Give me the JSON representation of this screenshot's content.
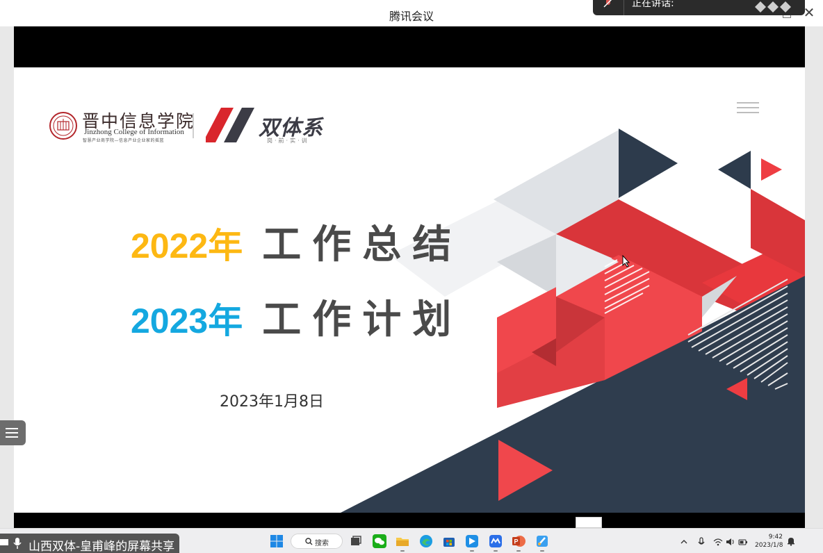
{
  "window": {
    "title": "腾讯会议"
  },
  "speaking": {
    "text": "正在讲话:"
  },
  "slide": {
    "school_name_cn": "晋中信息学院",
    "school_name_en": "Jinzhong College of Information",
    "school_motto": "智慧产业商学院—信息产业企业家的摇篮",
    "brand_name": "双体系",
    "brand_sub": "岗·前·实·训",
    "heading1": {
      "year": "2022年",
      "text": "工作总结"
    },
    "heading2": {
      "year": "2023年",
      "text": "工作计划"
    },
    "date": "2023年1月8日"
  },
  "screen_share": {
    "label": "山西双体-皇甫峰的屏幕共享"
  },
  "taskbar": {
    "search_label": "搜索",
    "apps": [
      "task-view",
      "wechat",
      "file-explorer",
      "edge",
      "microsoft-store",
      "app-blue",
      "tencent-meeting",
      "powerpoint",
      "paint"
    ],
    "time": "9:42",
    "date": "2023/1/8"
  },
  "colors": {
    "year_2022": "#fdb813",
    "year_2023": "#14a8e0",
    "red": "#e8383d",
    "navy": "#2b3a4b",
    "gray": "#d5d8dc"
  }
}
